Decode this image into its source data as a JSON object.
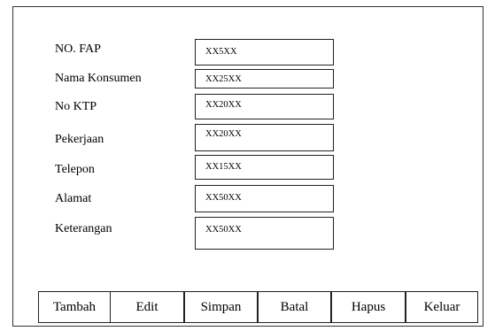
{
  "form": {
    "fields": [
      {
        "label": "NO. FAP",
        "value": "XX5XX"
      },
      {
        "label": "Nama Konsumen",
        "value": "XX25XX"
      },
      {
        "label": "No KTP",
        "value": "XX20XX"
      },
      {
        "label": "Pekerjaan",
        "value": "XX20XX"
      },
      {
        "label": "Telepon",
        "value": "XX15XX"
      },
      {
        "label": "Alamat",
        "value": "XX50XX"
      },
      {
        "label": "Keterangan",
        "value": "XX50XX"
      }
    ]
  },
  "buttons": {
    "tambah": "Tambah",
    "edit": "Edit",
    "simpan": "Simpan",
    "batal": "Batal",
    "hapus": "Hapus",
    "keluar": "Keluar"
  }
}
